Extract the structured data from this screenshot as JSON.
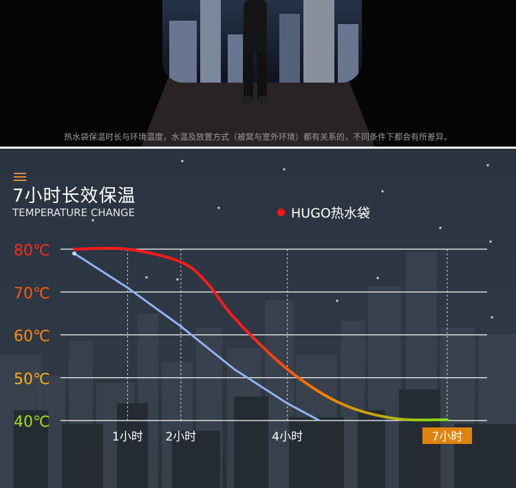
{
  "banner": {
    "caption": "热水袋保温时长与环境温度，水温及放置方式（被窝与室外环境）都有关系的，不同条件下都会有所差异。"
  },
  "chart": {
    "title": "7小时长效保温",
    "subtitle": "TEMPERATURE CHANGE",
    "legend_label": "HUGO热水袋"
  },
  "chart_data": {
    "type": "line",
    "title": "7小时长效保温",
    "subtitle": "TEMPERATURE CHANGE",
    "x_ticks": [
      "1小时",
      "2小时",
      "4小时",
      "7小时"
    ],
    "x_tick_values": [
      1,
      2,
      4,
      7
    ],
    "highlighted_tick": "7小时",
    "y_ticks": [
      "80℃",
      "70℃",
      "60℃",
      "50℃",
      "40℃"
    ],
    "y_tick_values": [
      80,
      70,
      60,
      50,
      40
    ],
    "xlim": [
      0,
      7
    ],
    "ylim": [
      40,
      80
    ],
    "grid": true,
    "legend_position": "top-right",
    "series": [
      {
        "name": "HUGO热水袋",
        "color": "#ff1a1a",
        "gradient": [
          "#ff1a1a",
          "#ff7a00",
          "#7ddc1f"
        ],
        "x": [
          0,
          1,
          2,
          2.5,
          3,
          4,
          5,
          6,
          7
        ],
        "y": [
          80,
          80,
          77,
          72,
          64,
          52,
          44,
          40.5,
          40.2
        ]
      },
      {
        "color": "#8fb4f3",
        "x": [
          0,
          1,
          2,
          3,
          4,
          4.6
        ],
        "y": [
          79,
          71,
          62,
          52,
          44,
          40
        ]
      }
    ],
    "colors": {
      "tick_80": "#ff2a1a",
      "tick_70": "#ff5a12",
      "tick_60": "#ff8a10",
      "tick_50": "#ffae14",
      "tick_40": "#a6dc1a",
      "highlight_bg": "#e0830e"
    }
  }
}
